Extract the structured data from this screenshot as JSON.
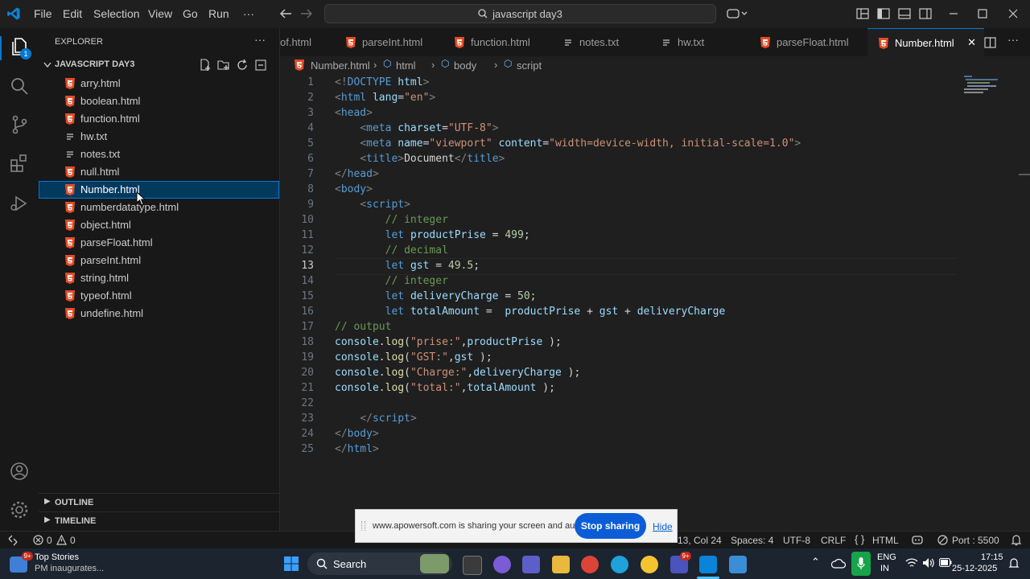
{
  "titlebar": {
    "menus": [
      "File",
      "Edit",
      "Selection",
      "View",
      "Go",
      "Run",
      "···"
    ],
    "search_text": "javascript day3"
  },
  "activity": {
    "badge": "1"
  },
  "sidebar": {
    "title": "EXPLORER",
    "folder": "JAVASCRIPT DAY3",
    "files": [
      {
        "name": "arry.html",
        "type": "html"
      },
      {
        "name": "boolean.html",
        "type": "html"
      },
      {
        "name": "function.html",
        "type": "html"
      },
      {
        "name": "hw.txt",
        "type": "txt"
      },
      {
        "name": "notes.txt",
        "type": "txt"
      },
      {
        "name": "null.html",
        "type": "html"
      },
      {
        "name": "Number.html",
        "type": "html",
        "selected": true
      },
      {
        "name": "numberdatatype.html",
        "type": "html"
      },
      {
        "name": "object.html",
        "type": "html"
      },
      {
        "name": "parseFloat.html",
        "type": "html"
      },
      {
        "name": "parseInt.html",
        "type": "html"
      },
      {
        "name": "string.html",
        "type": "html"
      },
      {
        "name": "typeof.html",
        "type": "html"
      },
      {
        "name": "undefine.html",
        "type": "html"
      }
    ],
    "outline": "OUTLINE",
    "timeline": "TIMELINE"
  },
  "tabs": [
    {
      "label": "of.html",
      "type": "none"
    },
    {
      "label": "parseInt.html",
      "type": "html"
    },
    {
      "label": "function.html",
      "type": "html"
    },
    {
      "label": "notes.txt",
      "type": "txt"
    },
    {
      "label": "hw.txt",
      "type": "txt"
    },
    {
      "label": "parseFloat.html",
      "type": "html"
    },
    {
      "label": "Number.html",
      "type": "html",
      "active": true
    }
  ],
  "breadcrumb": [
    "Number.html",
    "html",
    "body",
    "script"
  ],
  "editor": {
    "current_line": 13,
    "lines": [
      [
        [
          "p",
          "<!"
        ],
        [
          "tag",
          "DOCTYPE"
        ],
        [
          "tx",
          " "
        ],
        [
          "attr",
          "html"
        ],
        [
          "p",
          ">"
        ]
      ],
      [
        [
          "p",
          "<"
        ],
        [
          "tag",
          "html"
        ],
        [
          "tx",
          " "
        ],
        [
          "attr",
          "lang"
        ],
        [
          "tx",
          "="
        ],
        [
          "str",
          "\"en\""
        ],
        [
          "p",
          ">"
        ]
      ],
      [
        [
          "p",
          "<"
        ],
        [
          "tag",
          "head"
        ],
        [
          "p",
          ">"
        ]
      ],
      [
        [
          "tx",
          "    "
        ],
        [
          "p",
          "<"
        ],
        [
          "tag",
          "meta"
        ],
        [
          "tx",
          " "
        ],
        [
          "attr",
          "charset"
        ],
        [
          "tx",
          "="
        ],
        [
          "str",
          "\"UTF-8\""
        ],
        [
          "p",
          ">"
        ]
      ],
      [
        [
          "tx",
          "    "
        ],
        [
          "p",
          "<"
        ],
        [
          "tag",
          "meta"
        ],
        [
          "tx",
          " "
        ],
        [
          "attr",
          "name"
        ],
        [
          "tx",
          "="
        ],
        [
          "str",
          "\"viewport\""
        ],
        [
          "tx",
          " "
        ],
        [
          "attr",
          "content"
        ],
        [
          "tx",
          "="
        ],
        [
          "str",
          "\"width=device-width, initial-scale=1.0\""
        ],
        [
          "p",
          ">"
        ]
      ],
      [
        [
          "tx",
          "    "
        ],
        [
          "p",
          "<"
        ],
        [
          "tag",
          "title"
        ],
        [
          "p",
          ">"
        ],
        [
          "tx",
          "Document"
        ],
        [
          "p",
          "</"
        ],
        [
          "tag",
          "title"
        ],
        [
          "p",
          ">"
        ]
      ],
      [
        [
          "p",
          "</"
        ],
        [
          "tag",
          "head"
        ],
        [
          "p",
          ">"
        ]
      ],
      [
        [
          "p",
          "<"
        ],
        [
          "tag",
          "body"
        ],
        [
          "p",
          ">"
        ]
      ],
      [
        [
          "tx",
          "    "
        ],
        [
          "p",
          "<"
        ],
        [
          "tag",
          "script"
        ],
        [
          "p",
          ">"
        ]
      ],
      [
        [
          "tx",
          "        "
        ],
        [
          "cm",
          "// integer"
        ]
      ],
      [
        [
          "tx",
          "        "
        ],
        [
          "kw",
          "let"
        ],
        [
          "tx",
          " "
        ],
        [
          "var",
          "productPrise"
        ],
        [
          "tx",
          " = "
        ],
        [
          "num",
          "499"
        ],
        [
          "tx",
          ";"
        ]
      ],
      [
        [
          "tx",
          "        "
        ],
        [
          "cm",
          "// decimal"
        ]
      ],
      [
        [
          "tx",
          "        "
        ],
        [
          "kw",
          "let"
        ],
        [
          "tx",
          " "
        ],
        [
          "var",
          "gst"
        ],
        [
          "tx",
          " = "
        ],
        [
          "num",
          "49.5"
        ],
        [
          "tx",
          ";"
        ]
      ],
      [
        [
          "tx",
          "        "
        ],
        [
          "cm",
          "// integer"
        ]
      ],
      [
        [
          "tx",
          "        "
        ],
        [
          "kw",
          "let"
        ],
        [
          "tx",
          " "
        ],
        [
          "var",
          "deliveryCharge"
        ],
        [
          "tx",
          " = "
        ],
        [
          "num",
          "50"
        ],
        [
          "tx",
          ";"
        ]
      ],
      [
        [
          "tx",
          "        "
        ],
        [
          "kw",
          "let"
        ],
        [
          "tx",
          " "
        ],
        [
          "var",
          "totalAmount"
        ],
        [
          "tx",
          " =  "
        ],
        [
          "var",
          "productPrise"
        ],
        [
          "tx",
          " + "
        ],
        [
          "var",
          "gst"
        ],
        [
          "tx",
          " + "
        ],
        [
          "var",
          "deliveryCharge"
        ]
      ],
      [
        [
          "cm",
          "// output"
        ]
      ],
      [
        [
          "var",
          "console"
        ],
        [
          "tx",
          "."
        ],
        [
          "fn",
          "log"
        ],
        [
          "tx",
          "("
        ],
        [
          "str",
          "\"prise:\""
        ],
        [
          "tx",
          ","
        ],
        [
          "var",
          "productPrise"
        ],
        [
          "tx",
          " );"
        ]
      ],
      [
        [
          "var",
          "console"
        ],
        [
          "tx",
          "."
        ],
        [
          "fn",
          "log"
        ],
        [
          "tx",
          "("
        ],
        [
          "str",
          "\"GST:\""
        ],
        [
          "tx",
          ","
        ],
        [
          "var",
          "gst"
        ],
        [
          "tx",
          " );"
        ]
      ],
      [
        [
          "var",
          "console"
        ],
        [
          "tx",
          "."
        ],
        [
          "fn",
          "log"
        ],
        [
          "tx",
          "("
        ],
        [
          "str",
          "\"Charge:\""
        ],
        [
          "tx",
          ","
        ],
        [
          "var",
          "deliveryCharge"
        ],
        [
          "tx",
          " );"
        ]
      ],
      [
        [
          "var",
          "console"
        ],
        [
          "tx",
          "."
        ],
        [
          "fn",
          "log"
        ],
        [
          "tx",
          "("
        ],
        [
          "str",
          "\"total:\""
        ],
        [
          "tx",
          ","
        ],
        [
          "var",
          "totalAmount"
        ],
        [
          "tx",
          " );"
        ]
      ],
      [],
      [
        [
          "tx",
          "    "
        ],
        [
          "p",
          "</"
        ],
        [
          "tag",
          "script"
        ],
        [
          "p",
          ">"
        ]
      ],
      [
        [
          "p",
          "</"
        ],
        [
          "tag",
          "body"
        ],
        [
          "p",
          ">"
        ]
      ],
      [
        [
          "p",
          "</"
        ],
        [
          "tag",
          "html"
        ],
        [
          "p",
          ">"
        ]
      ]
    ]
  },
  "status": {
    "errors": "0",
    "warnings": "0",
    "cursor": "13, Col 24",
    "spaces": "Spaces: 4",
    "encoding": "UTF-8",
    "eol": "CRLF",
    "language": "HTML",
    "port": "Port : 5500"
  },
  "share_banner": {
    "text": "www.apowersoft.com is sharing your screen and audio.",
    "stop_label": "Stop sharing",
    "hide_label": "Hide"
  },
  "taskbar": {
    "news_title": "Top Stories",
    "news_sub": "PM inaugurates...",
    "news_badge": "9+",
    "search_label": "Search",
    "teams_badge": "9+",
    "lang1": "ENG",
    "lang2": "IN",
    "time": "17:15",
    "date": "25-12-2025"
  },
  "colors": {
    "accent": "#0078d4",
    "html_icon": "#e44d26",
    "editor_bg": "#1f1f1f"
  }
}
